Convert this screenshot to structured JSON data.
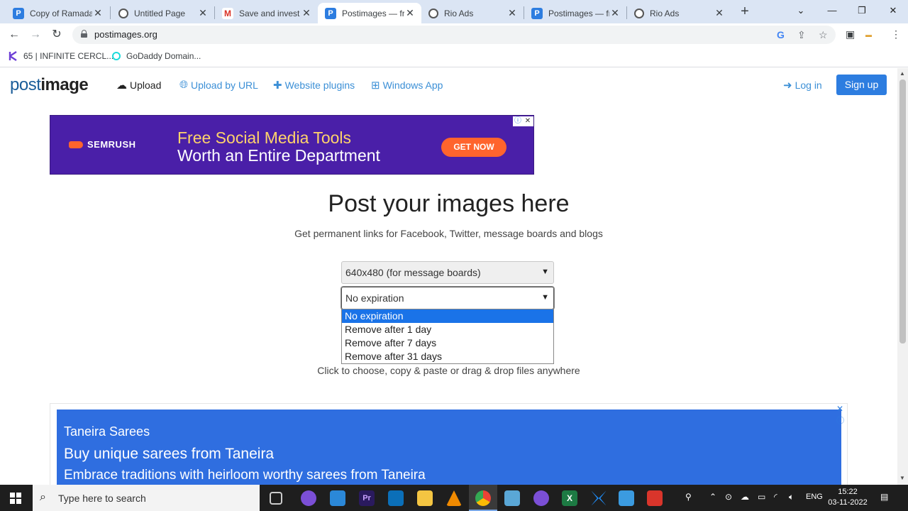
{
  "browser": {
    "tabs": [
      {
        "title": "Copy of Ramada",
        "icon": "postimages-icon"
      },
      {
        "title": "Untitled Page",
        "icon": "globe-icon"
      },
      {
        "title": "Save and invest",
        "icon": "gmail-icon"
      },
      {
        "title": "Postimages — fr",
        "icon": "postimages-icon",
        "active": true
      },
      {
        "title": "Rio Ads",
        "icon": "globe-icon"
      },
      {
        "title": "Postimages — fr",
        "icon": "postimages-icon"
      },
      {
        "title": "Rio Ads",
        "icon": "globe-icon"
      }
    ],
    "url": "postimages.org",
    "bookmarks": [
      {
        "label": "65 | INFINITE CERCL..."
      },
      {
        "label": "GoDaddy Domain..."
      }
    ]
  },
  "site": {
    "logo_light": "post",
    "logo_bold": "image",
    "nav": {
      "upload": "Upload",
      "upload_url": "Upload by URL",
      "plugins": "Website plugins",
      "windows_app": "Windows App",
      "login": "Log in",
      "signup": "Sign up"
    }
  },
  "ad_top": {
    "brand": "SEMRUSH",
    "line1": "Free Social Media Tools",
    "line2": "Worth an Entire Department",
    "cta": "GET NOW"
  },
  "main": {
    "headline": "Post your images here",
    "subtitle": "Get permanent links for Facebook, Twitter, message boards and blogs",
    "resize_select": "640x480 (for message boards)",
    "expiration_select": "No expiration",
    "expiration_options": [
      "No expiration",
      "Remove after 1 day",
      "Remove after 7 days",
      "Remove after 31 days"
    ],
    "selected_option_index": 0,
    "hint": "Click to choose, copy & paste or drag & drop files anywhere"
  },
  "ad_bottom": {
    "advertiser": "Taneira Sarees",
    "headline": "Buy unique sarees from Taneira",
    "description": "Embrace traditions with heirloom worthy sarees from Taneira"
  },
  "taskbar": {
    "search_placeholder": "Type here to search",
    "language": "ENG",
    "time": "15:22",
    "date": "03-11-2022"
  },
  "colors": {
    "brand_blue": "#2d7de0",
    "ad_purple": "#4a1fa8",
    "ad_orange": "#ff642d",
    "selection_blue": "#1a73e8"
  }
}
